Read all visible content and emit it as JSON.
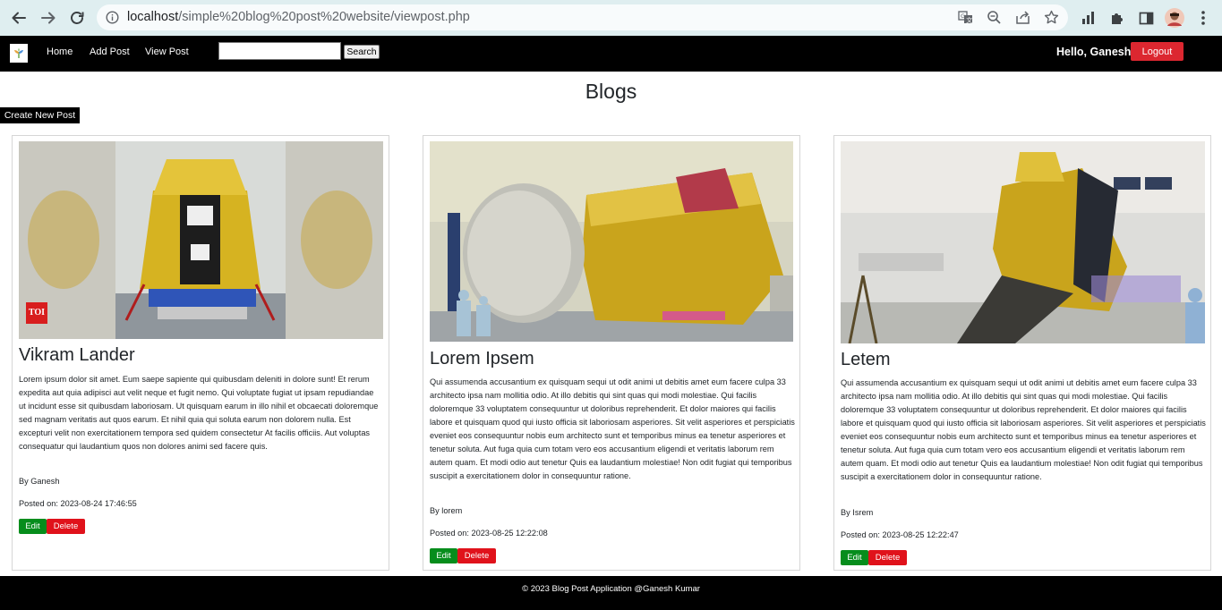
{
  "browser": {
    "url_host": "localhost",
    "url_path": "/simple%20blog%20post%20website/viewpost.php"
  },
  "navbar": {
    "links": [
      "Home",
      "Add Post",
      "View Post"
    ],
    "search_button": "Search",
    "greeting": "Hello, Ganesh",
    "logout": "Logout"
  },
  "page": {
    "title": "Blogs",
    "create_button": "Create New Post"
  },
  "posts": [
    {
      "title": "Vikram Lander",
      "image_badge": "TOI",
      "body": "Lorem ipsum dolor sit amet. Eum saepe sapiente qui quibusdam deleniti in dolore sunt! Et rerum expedita aut quia adipisci aut velit neque et fugit nemo. Qui voluptate fugiat ut ipsam repudiandae ut incidunt esse sit quibusdam laboriosam. Ut quisquam earum in illo nihil et obcaecati doloremque sed magnam veritatis aut quos earum. Et nihil quia qui soluta earum non dolorem nulla. Est excepturi velit non exercitationem tempora sed quidem consectetur At facilis officiis. Aut voluptas consequatur qui laudantium quos non dolores animi sed facere quis.",
      "author": "By Ganesh",
      "posted": "Posted on: 2023-08-24 17:46:55",
      "edit": "Edit",
      "delete": "Delete"
    },
    {
      "title": "Lorem Ipsem",
      "body": "Qui assumenda accusantium ex quisquam sequi ut odit animi ut debitis amet eum facere culpa 33 architecto ipsa nam mollitia odio. At illo debitis qui sint quas qui modi molestiae. Qui facilis doloremque 33 voluptatem consequuntur ut doloribus reprehenderit. Et dolor maiores qui facilis labore et quisquam quod qui iusto officia sit laboriosam asperiores. Sit velit asperiores et perspiciatis eveniet eos consequuntur nobis eum architecto sunt et temporibus minus ea tenetur asperiores et tenetur soluta. Aut fuga quia cum totam vero eos accusantium eligendi et veritatis laborum rem autem quam. Et modi odio aut tenetur Quis ea laudantium molestiae! Non odit fugiat qui temporibus suscipit a exercitationem dolor in consequuntur ratione.",
      "author": "By lorem",
      "posted": "Posted on: 2023-08-25 12:22:08",
      "edit": "Edit",
      "delete": "Delete"
    },
    {
      "title": "Letem",
      "body": "Qui assumenda accusantium ex quisquam sequi ut odit animi ut debitis amet eum facere culpa 33 architecto ipsa nam mollitia odio. At illo debitis qui sint quas qui modi molestiae. Qui facilis doloremque 33 voluptatem consequuntur ut doloribus reprehenderit. Et dolor maiores qui facilis labore et quisquam quod qui iusto officia sit laboriosam asperiores. Sit velit asperiores et perspiciatis eveniet eos consequuntur nobis eum architecto sunt et temporibus minus ea tenetur asperiores et tenetur soluta. Aut fuga quia cum totam vero eos accusantium eligendi et veritatis laborum rem autem quam. Et modi odio aut tenetur Quis ea laudantium molestiae! Non odit fugiat qui temporibus suscipit a exercitationem dolor in consequuntur ratione.",
      "author": "By Isrem",
      "posted": "Posted on: 2023-08-25 12:22:47",
      "edit": "Edit",
      "delete": "Delete"
    }
  ],
  "footer": {
    "text": "© 2023 Blog Post Application @Ganesh Kumar"
  },
  "colors": {
    "navbar_bg": "#000000",
    "logout": "#dc2730",
    "edit": "#068d1c",
    "delete": "#e0121b",
    "chrome_bg": "#dfeef0"
  }
}
